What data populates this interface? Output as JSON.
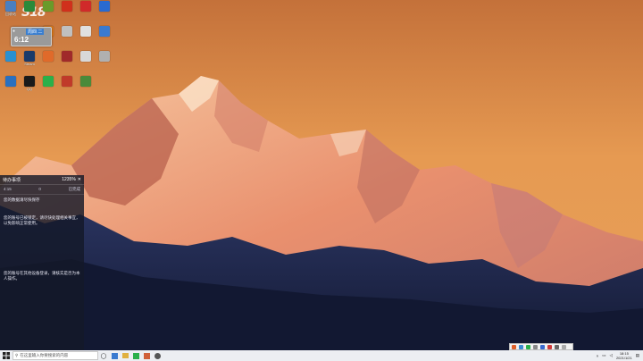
{
  "desktop": {
    "watermark": "S18",
    "colors": {
      "sky_top": "#c97a3a",
      "sky_mid": "#e39a50",
      "mountain_lit": "#f0b48a",
      "mountain_shadow": "#b96248",
      "foreground": "#1a2240"
    },
    "icons": [
      {
        "icon": "recycle-bin",
        "color": "#4a7fc0",
        "label": "回收站"
      },
      {
        "icon": "app",
        "color": "#2a8a3a",
        "label": ""
      },
      {
        "icon": "app",
        "color": "#6a9a2a",
        "label": ""
      },
      {
        "icon": "app",
        "color": "#d0301c",
        "label": ""
      },
      {
        "icon": "app",
        "color": "#d02a2a",
        "label": ""
      },
      {
        "icon": "app",
        "color": "#2a6ad0",
        "label": ""
      },
      {
        "icon": "app",
        "color": "#e07a1a",
        "label": ""
      },
      {
        "icon": "app",
        "color": "#c0c0c0",
        "label": ""
      },
      {
        "icon": "app",
        "color": "#e0e0e0",
        "label": ""
      },
      {
        "icon": "app",
        "color": "#3a7ad0",
        "label": ""
      },
      {
        "icon": "app",
        "color": "#2a90d0",
        "label": ""
      },
      {
        "icon": "steam",
        "color": "#1a3a6a",
        "label": "Steam"
      },
      {
        "icon": "app",
        "color": "#e06a2a",
        "label": ""
      },
      {
        "icon": "app",
        "color": "#a02a2a",
        "label": ""
      },
      {
        "icon": "app",
        "color": "#d8d8d8",
        "label": ""
      },
      {
        "icon": "app",
        "color": "#b0b0b0",
        "label": ""
      },
      {
        "icon": "app",
        "color": "#2a70c0",
        "label": ""
      },
      {
        "icon": "qq",
        "color": "#1a1a1a",
        "label": "QQ"
      },
      {
        "icon": "wechat",
        "color": "#2ab04a",
        "label": ""
      },
      {
        "icon": "app",
        "color": "#c03a2a",
        "label": ""
      },
      {
        "icon": "app",
        "color": "#4a8a3a",
        "label": ""
      }
    ],
    "clock_widget": {
      "date": "周四 二",
      "time": "6:12",
      "badge": "●"
    }
  },
  "panel": {
    "title": "待办事项",
    "header_right": "1235%",
    "stats": [
      "4:15",
      "0",
      "已完成"
    ],
    "notes": [
      "您的数据请尽快保存",
      "您的账号已被锁定，请尽快处理相关事宜，以免影响正常使用。",
      "您的账号在其他设备登录，请核实是否为本人操作。"
    ]
  },
  "taskbar": {
    "search_placeholder": "在这里输入你要搜索的内容",
    "clock_time": "18:15",
    "clock_date": "2021/1/21",
    "colors": {
      "bg": "#eceef2",
      "accent": "#0078d4"
    }
  }
}
